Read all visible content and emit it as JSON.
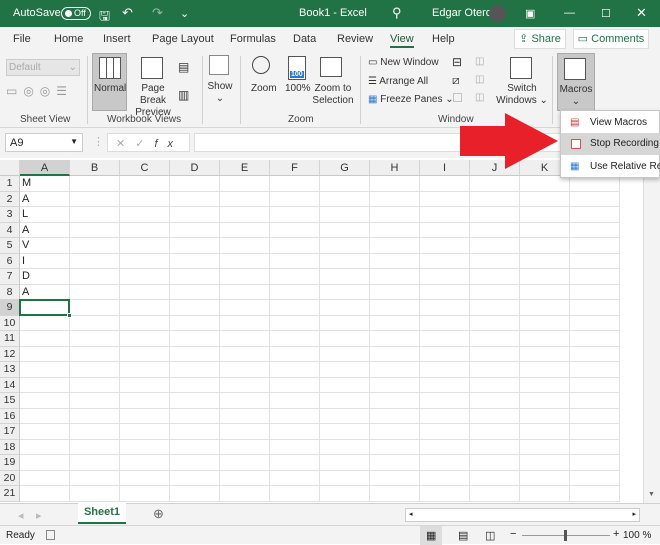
{
  "titlebar": {
    "autosave_label": "AutoSave",
    "autosave_state": "Off",
    "title": "Book1 - Excel",
    "user": "Edgar Otero"
  },
  "tabs": [
    "File",
    "Home",
    "Insert",
    "Page Layout",
    "Formulas",
    "Data",
    "Review",
    "View",
    "Help"
  ],
  "active_tab": "View",
  "share_label": "Share",
  "comments_label": "Comments",
  "ribbon": {
    "sheet_view": {
      "select_value": "Default",
      "group": "Sheet View"
    },
    "workbook_views": {
      "normal": "Normal",
      "page_break_1": "Page Break",
      "page_break_2": "Preview",
      "group": "Workbook Views"
    },
    "show": {
      "label": "Show"
    },
    "zoom": {
      "zoom": "Zoom",
      "hundred": "100%",
      "zts_1": "Zoom to",
      "zts_2": "Selection",
      "group": "Zoom",
      "icon_badge": "100"
    },
    "window": {
      "new_window": "New Window",
      "arrange_all": "Arrange All",
      "freeze_panes": "Freeze Panes",
      "switch_1": "Switch",
      "switch_2": "Windows",
      "group": "Window"
    },
    "macros": {
      "label": "Macros"
    }
  },
  "macro_menu": [
    {
      "label": "View Macros",
      "icon": "view-macros-icon"
    },
    {
      "label": "Stop Recording",
      "icon": "stop-recording-icon",
      "highlighted": true
    },
    {
      "label": "Use Relative Refer…",
      "icon": "relative-reference-icon"
    }
  ],
  "formula_bar": {
    "name_box": "A9",
    "formula": ""
  },
  "columns": [
    "A",
    "B",
    "C",
    "D",
    "E",
    "F",
    "G",
    "H",
    "I",
    "J",
    "K",
    "L"
  ],
  "rows": 21,
  "cells": {
    "A1": "M",
    "A2": "A",
    "A3": "L",
    "A4": "A",
    "A5": "V",
    "A6": "I",
    "A7": "D",
    "A8": "A"
  },
  "selected_cell": "A9",
  "sheets": [
    "Sheet1"
  ],
  "status": {
    "text": "Ready",
    "zoom": "100 %"
  },
  "colors": {
    "excel_green": "#217346",
    "arrow_red": "#e8202a"
  }
}
